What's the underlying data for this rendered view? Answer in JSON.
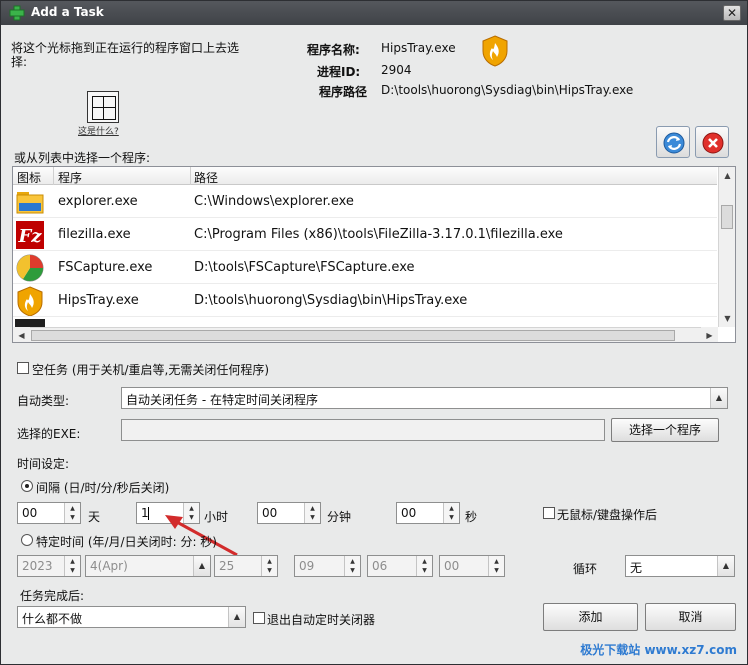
{
  "window": {
    "title": "Add a Task",
    "close_glyph": "✕"
  },
  "drag": {
    "instruction": "将这个光标拖到正在运行的程序窗口上去选择:",
    "what_link": "这是什么?"
  },
  "info": {
    "program_name_label": "程序名称:",
    "program_name_value": "HipsTray.exe",
    "pid_label": "进程ID:",
    "pid_value": "2904",
    "path_label": "程序路径",
    "path_value": "D:\\tools\\huorong\\Sysdiag\\bin\\HipsTray.exe",
    "icon": "huorong-shield-icon"
  },
  "list": {
    "select_label": "或从列表中选择一个程序:",
    "headers": {
      "icon": "图标",
      "program": "程序",
      "path": "路径"
    },
    "rows": [
      {
        "program": "explorer.exe",
        "path": "C:\\Windows\\explorer.exe",
        "icon": "folder-icon"
      },
      {
        "program": "filezilla.exe",
        "path": "C:\\Program Files (x86)\\tools\\FileZilla-3.17.0.1\\filezilla.exe",
        "icon": "filezilla-icon"
      },
      {
        "program": "FSCapture.exe",
        "path": "D:\\tools\\FSCapture\\FSCapture.exe",
        "icon": "fscapture-icon"
      },
      {
        "program": "HipsTray.exe",
        "path": "D:\\tools\\huorong\\Sysdiag\\bin\\HipsTray.exe",
        "icon": "huorong-icon"
      }
    ],
    "refresh_icon": "refresh-icon",
    "remove_icon": "close-icon"
  },
  "empty_task": {
    "label": "空任务 (用于关机/重启等,无需关闭任何程序)",
    "checked": false
  },
  "auto_type": {
    "label": "自动类型:",
    "value": "自动关闭任务 - 在特定时间关闭程序"
  },
  "exe": {
    "label": "选择的EXE:",
    "value": "",
    "select_button": "选择一个程序"
  },
  "time": {
    "label": "时间设定:",
    "interval_label": "间隔 (日/时/分/秒后关闭)",
    "days_value": "00",
    "days_unit": "天",
    "hours_value": "1",
    "hours_unit": "小时",
    "minutes_value": "00",
    "minutes_unit": "分钟",
    "seconds_value": "00",
    "seconds_unit": "秒",
    "idle_label": "无鼠标/键盘操作后",
    "specific_label": "特定时间 (年/月/日关闭时: 分: 秒)",
    "year": "2023",
    "month": "4(Apr)",
    "day": "25",
    "hour": "09",
    "minute": "06",
    "second": "00",
    "loop_label": "循环",
    "loop_value": "无"
  },
  "after": {
    "label": "任务完成后:",
    "value": "什么都不做",
    "exit_label": "退出自动定时关闭器"
  },
  "buttons": {
    "add": "添加",
    "cancel": "取消"
  },
  "watermark": "极光下载站 www.xz7.com",
  "colors": {
    "titlebar": "#4a4d52",
    "dialog_bg": "#e9eaea",
    "annotation_arrow": "#d22b2b"
  }
}
